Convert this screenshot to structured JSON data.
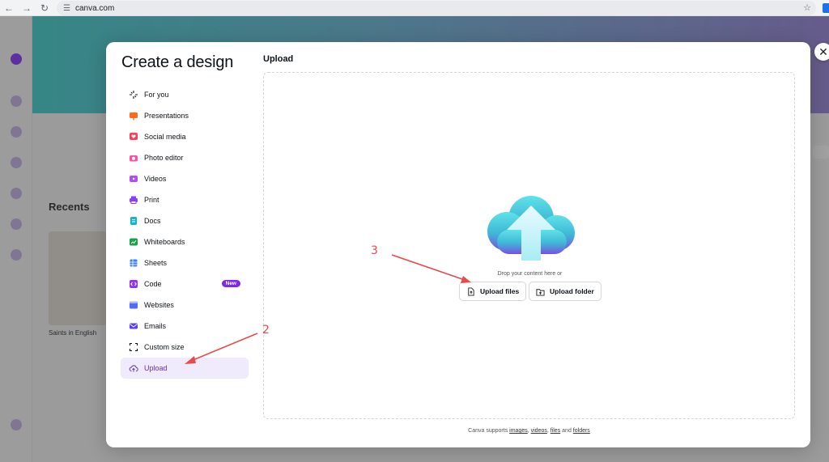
{
  "browser": {
    "url": "canva.com",
    "icons": [
      "back-arrow-icon",
      "forward-arrow-icon",
      "reload-icon",
      "site-settings-icon",
      "bookmark-star-icon"
    ]
  },
  "modal": {
    "title": "Create a design",
    "menu": [
      {
        "label": "For you",
        "icon": "sparkle-icon",
        "color": "#0e1318"
      },
      {
        "label": "Presentations",
        "icon": "presentation-icon",
        "color": "#ff6b1a"
      },
      {
        "label": "Social media",
        "icon": "heart-icon",
        "color": "#ff3d5a"
      },
      {
        "label": "Photo editor",
        "icon": "camera-icon",
        "color": "#ff4fa6"
      },
      {
        "label": "Videos",
        "icon": "video-icon",
        "color": "#b34cf5"
      },
      {
        "label": "Print",
        "icon": "printer-icon",
        "color": "#8b3dff"
      },
      {
        "label": "Docs",
        "icon": "doc-icon",
        "color": "#13b5d1"
      },
      {
        "label": "Whiteboards",
        "icon": "whiteboard-icon",
        "color": "#16a34a"
      },
      {
        "label": "Sheets",
        "icon": "sheet-icon",
        "color": "#3b82f6"
      },
      {
        "label": "Code",
        "icon": "code-icon",
        "color": "#9333ea",
        "badge": "New"
      },
      {
        "label": "Websites",
        "icon": "website-icon",
        "color": "#4f6bff"
      },
      {
        "label": "Emails",
        "icon": "email-icon",
        "color": "#5b3ef5"
      },
      {
        "label": "Custom size",
        "icon": "custom-size-icon",
        "color": "#0e1318"
      },
      {
        "label": "Upload",
        "icon": "cloud-upload-icon",
        "color": "#5a32c5",
        "active": true
      }
    ],
    "upload": {
      "title": "Upload",
      "drop_text": "Drop your content here or",
      "upload_files_label": "Upload files",
      "upload_folder_label": "Upload folder",
      "footer_prefix": "Canva supports",
      "footer_images": "images",
      "footer_videos": "videos",
      "footer_files": "files",
      "footer_and": "and",
      "footer_folders": "folders"
    },
    "close_icon": "close-icon"
  },
  "background": {
    "recents_label": "Recents",
    "thumb_label": "Saints in English"
  },
  "annotations": {
    "step2": "2",
    "step3": "3",
    "color": "#e84b4b"
  }
}
